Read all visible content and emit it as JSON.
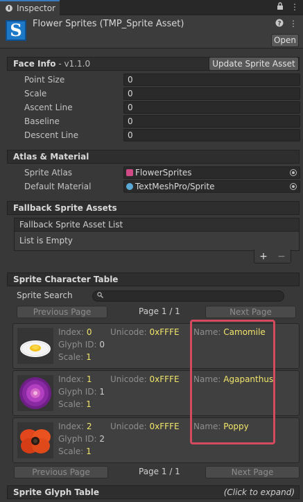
{
  "tab": {
    "label": "Inspector"
  },
  "header": {
    "title": "Flower Sprites (TMP_Sprite Asset)",
    "logo_letter": "S",
    "open_label": "Open",
    "help_glyph": "?",
    "menu_glyph": "⋮",
    "lock_glyph": "🔒",
    "more_glyph": "⋮"
  },
  "face_info": {
    "title": "Face Info",
    "version": " - v1.1.0",
    "update_button": "Update Sprite Asset",
    "fields": [
      {
        "label": "Point Size",
        "value": "0"
      },
      {
        "label": "Scale",
        "value": "0"
      },
      {
        "label": "Ascent Line",
        "value": "0"
      },
      {
        "label": "Baseline",
        "value": "0"
      },
      {
        "label": "Descent Line",
        "value": "0"
      }
    ]
  },
  "atlas": {
    "title": "Atlas & Material",
    "sprite_atlas_label": "Sprite Atlas",
    "sprite_atlas_value": "FlowerSprites",
    "material_label": "Default Material",
    "material_value": "TextMeshPro/Sprite"
  },
  "fallback": {
    "title": "Fallback Sprite Assets",
    "list_header": "Fallback Sprite Asset List",
    "empty_text": "List is Empty",
    "add_glyph": "+",
    "remove_glyph": "−"
  },
  "sprite_table": {
    "title": "Sprite Character Table",
    "search_label": "Sprite Search",
    "search_icon": "🔍",
    "prev_label": "Previous Page",
    "next_label": "Next Page",
    "page_text": "Page 1 / 1",
    "labels": {
      "index": "Index:",
      "unicode": "Unicode:",
      "glyph": "Glyph ID:",
      "scale": "Scale:",
      "name": "Name:"
    },
    "items": [
      {
        "index": "0",
        "unicode": "0xFFFE",
        "glyph_id": "0",
        "scale": "1",
        "name": "Camomile",
        "icon": "camomile-flower"
      },
      {
        "index": "1",
        "unicode": "0xFFFE",
        "glyph_id": "1",
        "scale": "1",
        "name": "Agapanthus",
        "icon": "agapanthus-flower"
      },
      {
        "index": "2",
        "unicode": "0xFFFE",
        "glyph_id": "2",
        "scale": "1",
        "name": "Poppy",
        "icon": "poppy-flower"
      }
    ]
  },
  "glyph_table": {
    "title": "Sprite Glyph Table",
    "expand_hint": "(Click to expand)"
  },
  "colors": {
    "highlight": "#d54a5f",
    "value_yellow": "#f2e56b",
    "accent": "#3a79bb"
  }
}
